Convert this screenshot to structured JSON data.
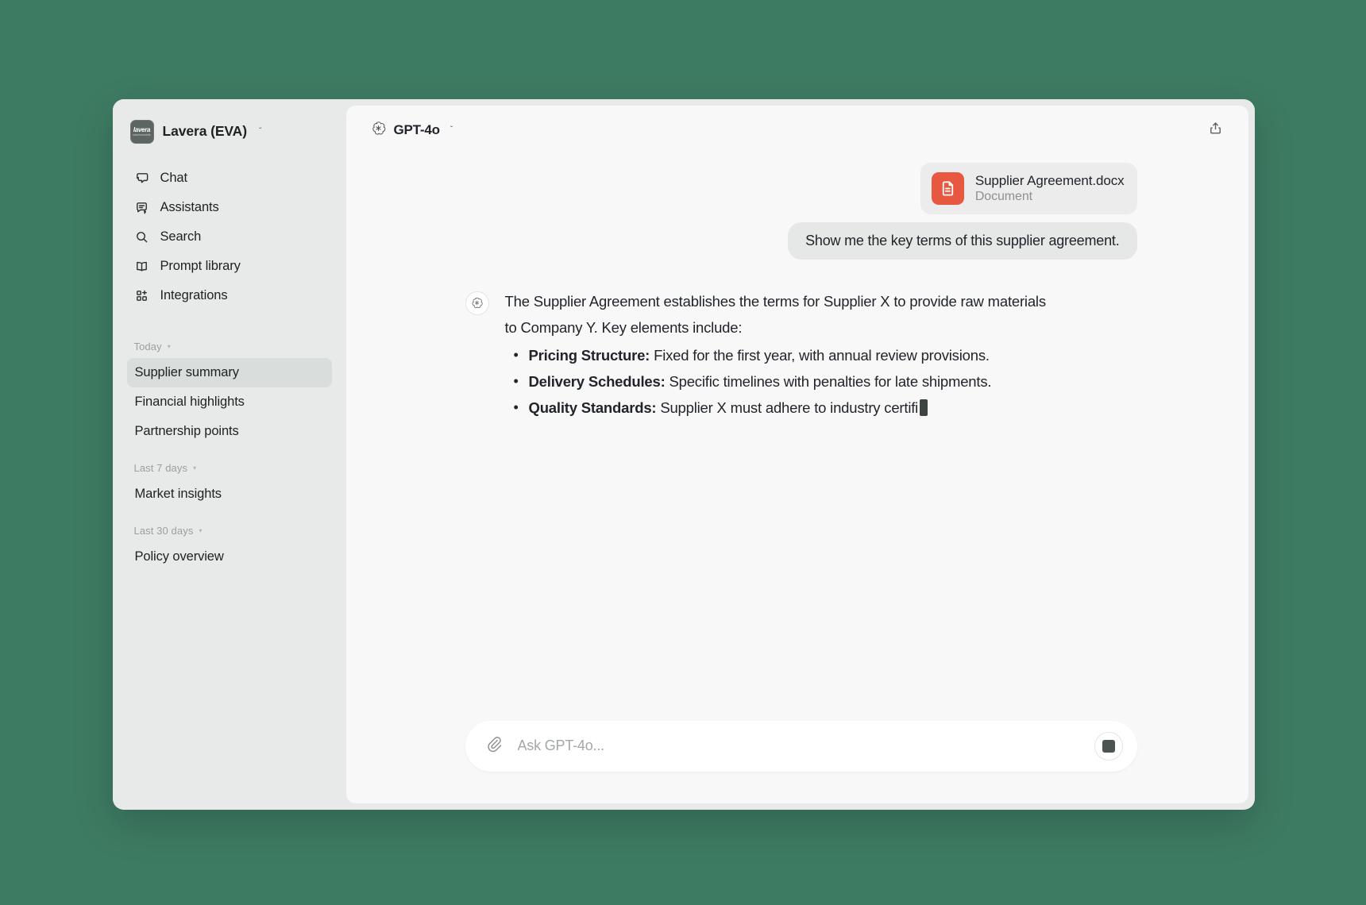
{
  "workspace": {
    "name": "Lavera (EVA)",
    "logo_top": "lavera",
    "logo_bottom": "naturkosmetik",
    "chevron": "ˇ"
  },
  "sidebar": {
    "nav": [
      {
        "label": "Chat",
        "icon": "chat-icon"
      },
      {
        "label": "Assistants",
        "icon": "assistants-icon"
      },
      {
        "label": "Search",
        "icon": "search-icon"
      },
      {
        "label": "Prompt library",
        "icon": "book-icon"
      },
      {
        "label": "Integrations",
        "icon": "integrations-icon"
      }
    ],
    "sections": [
      {
        "title": "Today",
        "caret": "▾",
        "items": [
          {
            "label": "Supplier summary",
            "active": true
          },
          {
            "label": "Financial highlights",
            "active": false
          },
          {
            "label": "Partnership points",
            "active": false
          }
        ]
      },
      {
        "title": "Last 7 days",
        "caret": "▾",
        "items": [
          {
            "label": "Market insights",
            "active": false
          }
        ]
      },
      {
        "title": "Last 30 days",
        "caret": "▾",
        "items": [
          {
            "label": "Policy overview",
            "active": false
          }
        ]
      }
    ]
  },
  "topbar": {
    "model": "GPT-4o",
    "model_chevron": "ˇ",
    "share_icon": "share-icon"
  },
  "conversation": {
    "attachment": {
      "name": "Supplier Agreement.docx",
      "kind": "Document",
      "icon_color": "#e8573f",
      "icon": "document-icon"
    },
    "user_message": "Show me the key terms of this supplier agreement.",
    "assistant": {
      "intro": "The Supplier Agreement establishes the terms for Supplier X to provide raw materials to Company Y. Key elements include:",
      "bullets": [
        {
          "term": "Pricing Structure:",
          "text": " Fixed for the first year, with annual review provisions."
        },
        {
          "term": "Delivery Schedules:",
          "text": " Specific timelines with penalties for late shipments."
        },
        {
          "term": "Quality Standards:",
          "text": " Supplier X must adhere to industry certifi"
        }
      ],
      "streaming": true
    }
  },
  "composer": {
    "placeholder": "Ask GPT-4o...",
    "value": "",
    "attach_icon": "paperclip-icon",
    "stop_icon": "stop-icon"
  },
  "colors": {
    "desktop_bg": "#3e7b63",
    "sidebar_bg": "#e8eae9",
    "main_bg": "#f7f8f7",
    "accent_file": "#e8573f",
    "active_item": "#d9dedc"
  }
}
